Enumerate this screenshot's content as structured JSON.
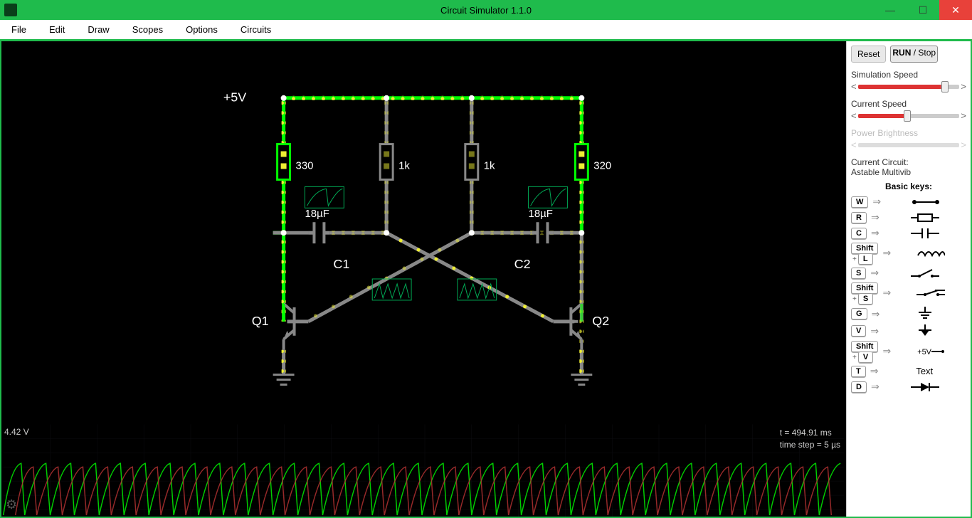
{
  "titlebar": {
    "title": "Circuit Simulator 1.1.0"
  },
  "menubar": {
    "items": [
      "File",
      "Edit",
      "Draw",
      "Scopes",
      "Options",
      "Circuits"
    ]
  },
  "circuit": {
    "voltage_label": "+5V",
    "r1": "330",
    "r2": "1k",
    "r3": "1k",
    "r4": "320",
    "c1_label": "C1",
    "c1_val": "18µF",
    "c2_label": "C2",
    "c2_val": "18µF",
    "q1": "Q1",
    "q2": "Q2"
  },
  "scope": {
    "voltage": "4.42 V",
    "time": "t = 494.91 ms",
    "timestep": "time step = 5 µs"
  },
  "sidebar": {
    "reset": "Reset",
    "run_prefix": "RUN",
    "run_suffix": " / Stop",
    "sliders": {
      "sim_speed": "Simulation Speed",
      "cur_speed": "Current Speed",
      "power": "Power Brightness"
    },
    "circuit_label": "Current Circuit:",
    "circuit_name": "Astable Multivib",
    "keys_title": "Basic keys:",
    "keys": [
      {
        "caps": [
          "W"
        ],
        "sym": "wire"
      },
      {
        "caps": [
          "R"
        ],
        "sym": "resistor"
      },
      {
        "caps": [
          "C"
        ],
        "sym": "capacitor"
      },
      {
        "caps": [
          "Shift",
          "L"
        ],
        "plus": true,
        "sym": "inductor"
      },
      {
        "caps": [
          "S"
        ],
        "sym": "switch-open"
      },
      {
        "caps": [
          "Shift",
          "S"
        ],
        "plus": true,
        "sym": "switch-closed"
      },
      {
        "caps": [
          "G"
        ],
        "sym": "ground"
      },
      {
        "caps": [
          "V"
        ],
        "sym": "ground-simple"
      },
      {
        "caps": [
          "Shift",
          "V"
        ],
        "plus": true,
        "sym": "vsource",
        "text": "+5V"
      },
      {
        "caps": [
          "T"
        ],
        "sym": "text",
        "text": "Text"
      },
      {
        "caps": [
          "D"
        ],
        "sym": "diode"
      }
    ]
  }
}
